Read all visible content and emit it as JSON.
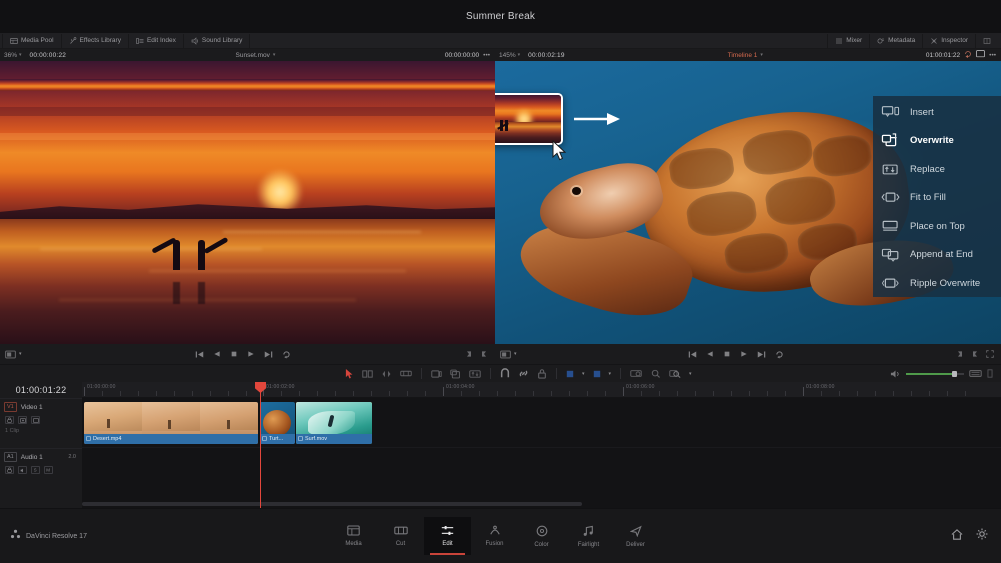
{
  "titlebar": {
    "project_title": "Summer Break"
  },
  "toolstrip": {
    "left_buttons": [
      {
        "label": "Media Pool",
        "icon": "media-pool-icon"
      },
      {
        "label": "Effects Library",
        "icon": "effects-library-icon"
      },
      {
        "label": "Edit Index",
        "icon": "edit-index-icon"
      },
      {
        "label": "Sound Library",
        "icon": "sound-library-icon"
      }
    ],
    "right_buttons": [
      {
        "label": "Mixer",
        "icon": "mixer-icon"
      },
      {
        "label": "Metadata",
        "icon": "metadata-icon"
      },
      {
        "label": "Inspector",
        "icon": "inspector-icon"
      }
    ]
  },
  "source_viewer": {
    "zoom": "36%",
    "timecode_in": "00:00:00:22",
    "clip_name": "Sunset.mov",
    "timecode_out": "00:00:00:00",
    "options_label": "•••"
  },
  "timeline_viewer": {
    "zoom": "145%",
    "timecode_in": "00:00:02:19",
    "clip_name": "Timeline 1",
    "timecode_out": "01:00:01:22",
    "options_label": "•••"
  },
  "edit_overlay_menu": {
    "items": [
      {
        "label": "Insert",
        "icon": "insert-icon",
        "active": false
      },
      {
        "label": "Overwrite",
        "icon": "overwrite-icon",
        "active": true
      },
      {
        "label": "Replace",
        "icon": "replace-icon",
        "active": false
      },
      {
        "label": "Fit to Fill",
        "icon": "fit-to-fill-icon",
        "active": false
      },
      {
        "label": "Place on Top",
        "icon": "place-on-top-icon",
        "active": false
      },
      {
        "label": "Append at End",
        "icon": "append-at-end-icon",
        "active": false
      },
      {
        "label": "Ripple Overwrite",
        "icon": "ripple-overwrite-icon",
        "active": false
      }
    ]
  },
  "timeline": {
    "playhead_timecode": "01:00:01:22",
    "ruler_labels": [
      "01:00:00:00",
      "01:00:02:00",
      "01:00:04:00",
      "01:00:06:00",
      "01:00:08:00"
    ],
    "tracks": [
      {
        "id": "V1",
        "name": "Video 1",
        "right_label": "",
        "clip_count": "1 Clip",
        "type": "video"
      },
      {
        "id": "A1",
        "name": "Audio 1",
        "right_label": "2.0",
        "clip_count": "",
        "type": "audio"
      }
    ],
    "clips": [
      {
        "name": "Desert.mp4",
        "track": "V1"
      },
      {
        "name": "Turt...",
        "track": "V1"
      },
      {
        "name": "Surf.mov",
        "track": "V1"
      }
    ]
  },
  "bottom_bar": {
    "app_name": "DaVinci Resolve 17",
    "pages": [
      {
        "label": "Media",
        "icon": "media-page-icon",
        "active": false
      },
      {
        "label": "Cut",
        "icon": "cut-page-icon",
        "active": false
      },
      {
        "label": "Edit",
        "icon": "edit-page-icon",
        "active": true
      },
      {
        "label": "Fusion",
        "icon": "fusion-page-icon",
        "active": false
      },
      {
        "label": "Color",
        "icon": "color-page-icon",
        "active": false
      },
      {
        "label": "Fairlight",
        "icon": "fairlight-page-icon",
        "active": false
      },
      {
        "label": "Deliver",
        "icon": "deliver-page-icon",
        "active": false
      }
    ],
    "right_icons": [
      "home-icon",
      "settings-gear-icon"
    ]
  },
  "colors": {
    "accent_red": "#c9443a",
    "playhead_red": "#e2473c",
    "clip_blue": "#2f6fa8",
    "menu_bg": "rgba(24,48,66,.88)",
    "panel_bg": "#1b1b1d"
  }
}
